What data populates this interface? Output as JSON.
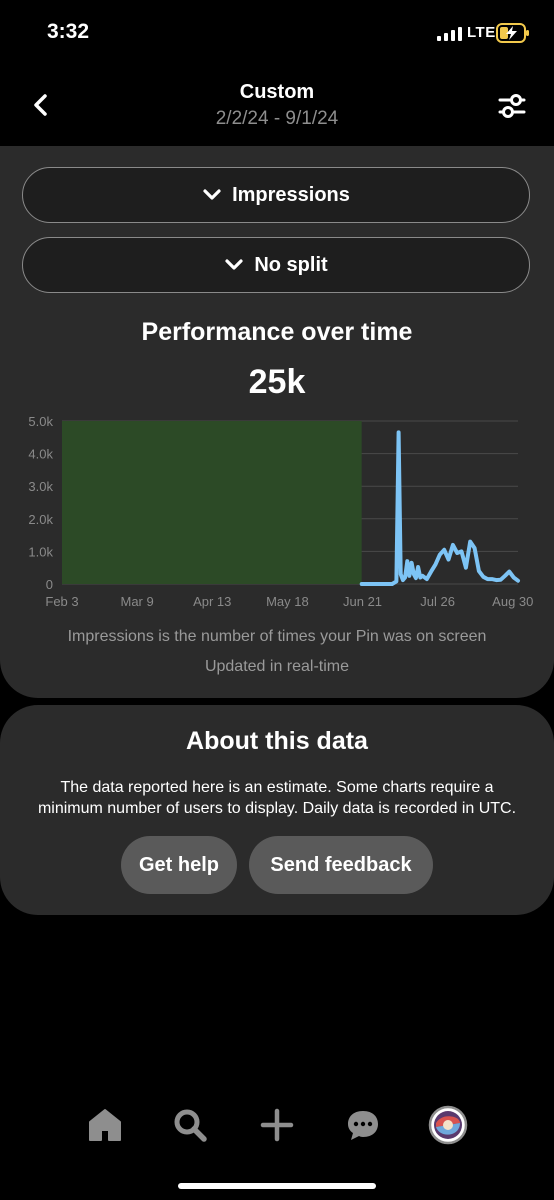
{
  "status_bar": {
    "time": "3:32",
    "network": "LTE"
  },
  "header": {
    "title": "Custom",
    "date_range": "2/2/24 - 9/1/24"
  },
  "selectors": {
    "metric": "Impressions",
    "split": "No split"
  },
  "performance": {
    "title": "Performance over time",
    "total": "25k"
  },
  "chart_data": {
    "type": "line",
    "x_tick_labels": [
      "Feb 3",
      "Mar 9",
      "Apr 13",
      "May 18",
      "Jun 21",
      "Jul 26",
      "Aug 30"
    ],
    "y_tick_labels": [
      "0",
      "1.0k",
      "2.0k",
      "3.0k",
      "4.0k",
      "5.0k"
    ],
    "ylim": [
      0,
      5000
    ],
    "grid": true,
    "shaded_region": {
      "from_day": 0,
      "to_day": 138,
      "color": "#2c4a26"
    },
    "series": [
      {
        "color": "#7dc4f5",
        "x_day": [
          138,
          143,
          148,
          152,
          154,
          155,
          156,
          157,
          158,
          159,
          160,
          161,
          162,
          163,
          164,
          165,
          166,
          168,
          170,
          172,
          174,
          176,
          178,
          180,
          182,
          184,
          186,
          188,
          190,
          192,
          194,
          196,
          198,
          200,
          202,
          204,
          206,
          208,
          210
        ],
        "values": [
          0,
          0,
          0,
          0,
          80,
          4650,
          300,
          120,
          200,
          700,
          250,
          650,
          300,
          180,
          520,
          200,
          250,
          150,
          380,
          600,
          900,
          1050,
          750,
          1200,
          950,
          1000,
          500,
          1300,
          1100,
          400,
          220,
          150,
          150,
          120,
          130,
          250,
          380,
          200,
          100
        ]
      }
    ]
  },
  "footnote": "Impressions is the number of times your Pin was on screen",
  "updated": "Updated in real-time",
  "about": {
    "title": "About this data",
    "text": "The data reported here is an estimate. Some charts require a minimum number of users to display. Daily data is recorded in UTC.",
    "help_label": "Get help",
    "feedback_label": "Send feedback"
  },
  "nav": {
    "icons": [
      "home-icon",
      "search-icon",
      "plus-icon",
      "chat-icon",
      "profile-avatar"
    ],
    "icon_color": "#8e8e8e"
  }
}
